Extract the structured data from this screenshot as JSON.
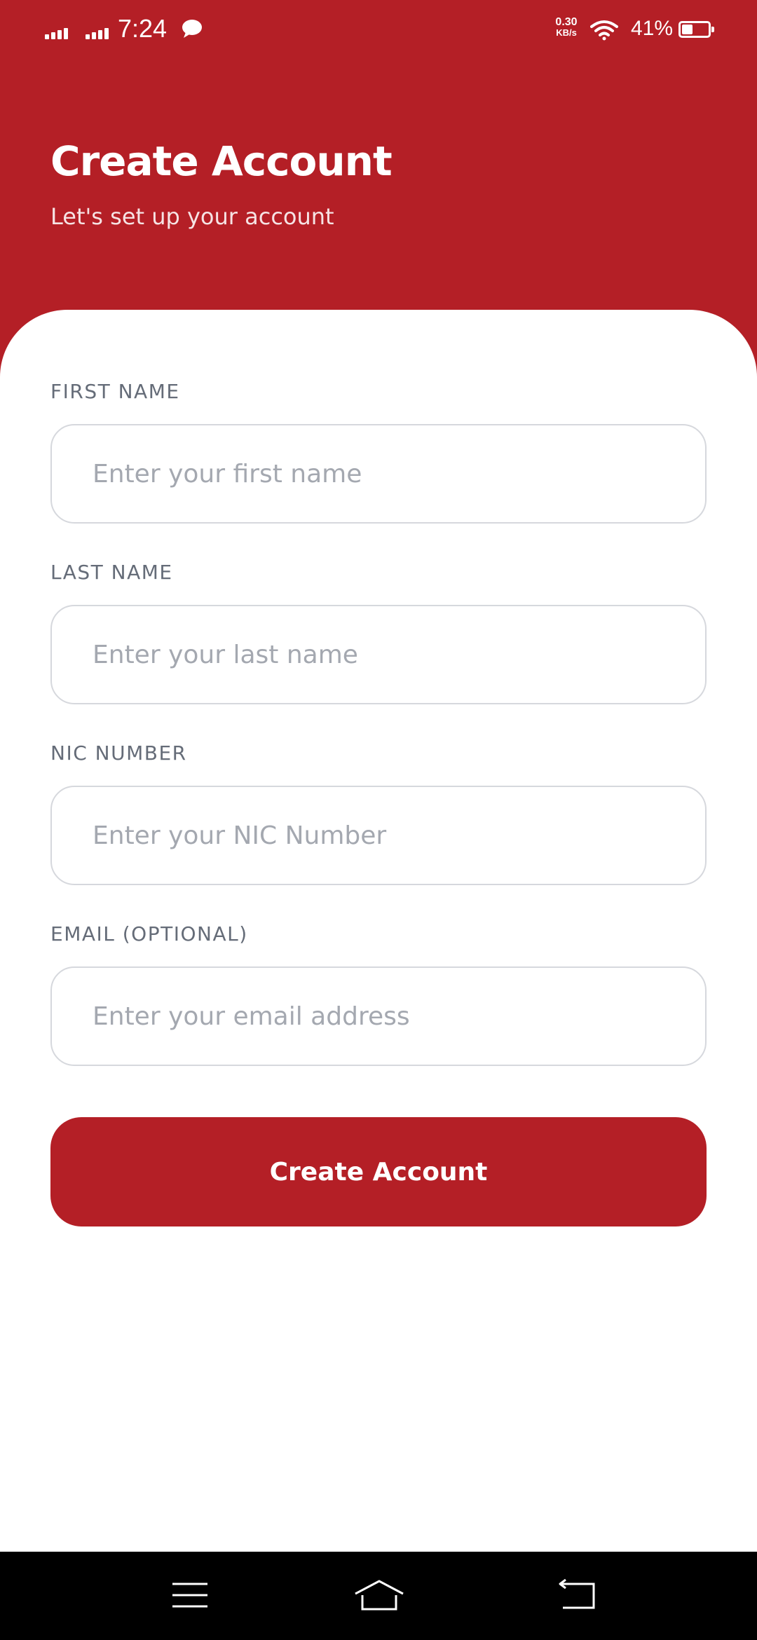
{
  "status_bar": {
    "time": "7:24",
    "net_speed_value": "0.30",
    "net_speed_unit": "KB/s",
    "battery_percent": "41%",
    "battery_level": 0.41,
    "icons": [
      "signal-icon",
      "signal-icon",
      "message-icon",
      "wifi-icon",
      "battery-icon"
    ]
  },
  "header": {
    "title": "Create Account",
    "subtitle": "Let's set up your account"
  },
  "form": {
    "fields": [
      {
        "label": "FIRST NAME",
        "placeholder": "Enter your first name",
        "value": ""
      },
      {
        "label": "LAST NAME",
        "placeholder": "Enter your last name",
        "value": ""
      },
      {
        "label": "NIC NUMBER",
        "placeholder": "Enter your NIC Number",
        "value": ""
      },
      {
        "label": "EMAIL (OPTIONAL)",
        "placeholder": "Enter your email address",
        "value": ""
      }
    ],
    "submit_label": "Create Account"
  },
  "nav_bar": {
    "icons": [
      "menu-icon",
      "home-icon",
      "back-icon"
    ]
  },
  "colors": {
    "brand": "#b41f26",
    "label": "#656c78",
    "placeholder": "#a4a8b0",
    "input_border": "#d6d8dd"
  }
}
